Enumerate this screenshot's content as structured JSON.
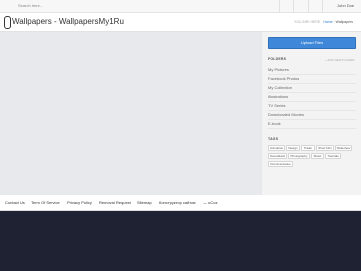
{
  "topbar": {
    "search_placeholder": "Search here...",
    "user_name": "John Doe"
  },
  "header": {
    "title": "Wallpapers - WallpapersMy1Ru",
    "breadcrumb_prefix": "YOU ARE HERE",
    "breadcrumb_home": "Home",
    "breadcrumb_current": "Wallpapers"
  },
  "sidebar": {
    "upload_label": "Upload Files",
    "folders_heading": "FOLDERS",
    "new_folder_label": "+ ADD NEW FOLDER",
    "folders": [
      "My Pictures",
      "Facebook Photos",
      "My Collection",
      "Illustrations",
      "TV Series",
      "Downloaded Movies",
      "E-book"
    ],
    "tags_heading": "TAGS",
    "tags": [
      "Animation",
      "Design",
      "Trailer",
      "Short Film",
      "Slideshow",
      "Soundtrack",
      "Photography",
      "Music",
      "Tutorials",
      "Documentaries"
    ]
  },
  "footer": {
    "links": [
      "Contact Us",
      "Term Of Service",
      "Privacy Policy",
      "Removal Request",
      "Sitemap",
      "Конструктор сайтов",
      "— uCoz"
    ]
  }
}
